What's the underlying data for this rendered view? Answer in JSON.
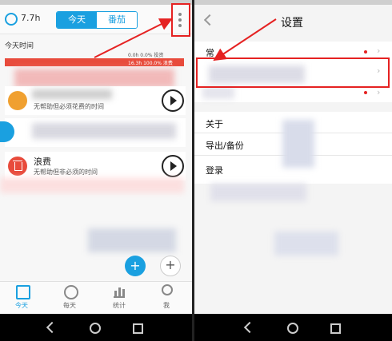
{
  "left": {
    "header": {
      "duration": "7.7h",
      "tab_today": "今天",
      "tab_tomato": "番茄"
    },
    "section_title": "今天时间",
    "stats": {
      "line1": "0.0h 0.0% 投资",
      "line2": "16.3h 100.0% 浪费"
    },
    "cards": [
      {
        "subtitle": "无帮助但必须花费的时间",
        "icon_color": "#f0a030"
      },
      {
        "title": "浪费",
        "subtitle": "无帮助但非必须的时间",
        "icon_color": "#e84b3c"
      }
    ],
    "bottom_tabs": [
      "今天",
      "每天",
      "统计",
      "我"
    ],
    "accent": "#1aa0e0"
  },
  "right": {
    "title": "设置",
    "rows": [
      "常",
      "关于",
      "导出/备份",
      "登录"
    ]
  }
}
